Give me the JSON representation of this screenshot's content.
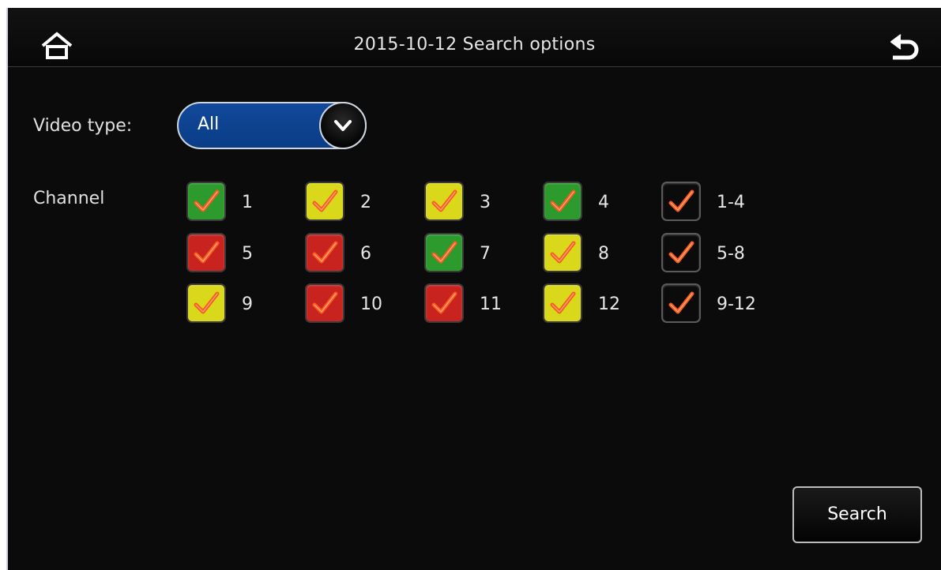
{
  "header": {
    "title": "2015-10-12  Search options",
    "home_icon": "home-icon",
    "back_icon": "back-icon"
  },
  "video_type": {
    "label": "Video type:",
    "value": "All",
    "arrow_icon": "chevron-down-icon"
  },
  "channel": {
    "label": "Channel",
    "items": [
      {
        "label": "1",
        "color": "green",
        "checked": true
      },
      {
        "label": "2",
        "color": "yellow",
        "checked": true
      },
      {
        "label": "3",
        "color": "yellow",
        "checked": true
      },
      {
        "label": "4",
        "color": "green",
        "checked": true
      },
      {
        "label": "1-4",
        "color": "dark",
        "checked": true
      },
      {
        "label": "5",
        "color": "red",
        "checked": true
      },
      {
        "label": "6",
        "color": "red",
        "checked": true
      },
      {
        "label": "7",
        "color": "green",
        "checked": true
      },
      {
        "label": "8",
        "color": "yellow",
        "checked": true
      },
      {
        "label": "5-8",
        "color": "dark",
        "checked": true
      },
      {
        "label": "9",
        "color": "yellow",
        "checked": true
      },
      {
        "label": "10",
        "color": "red",
        "checked": true
      },
      {
        "label": "11",
        "color": "red",
        "checked": true
      },
      {
        "label": "12",
        "color": "yellow",
        "checked": true
      },
      {
        "label": "9-12",
        "color": "dark",
        "checked": true
      }
    ]
  },
  "actions": {
    "search_label": "Search"
  },
  "colors": {
    "green": "#2c9a2c",
    "yellow": "#d9d81a",
    "red": "#c8231f",
    "dark": "#0b0b0b",
    "check": "#ff5a1e",
    "dropdown": "#0a3d86"
  }
}
